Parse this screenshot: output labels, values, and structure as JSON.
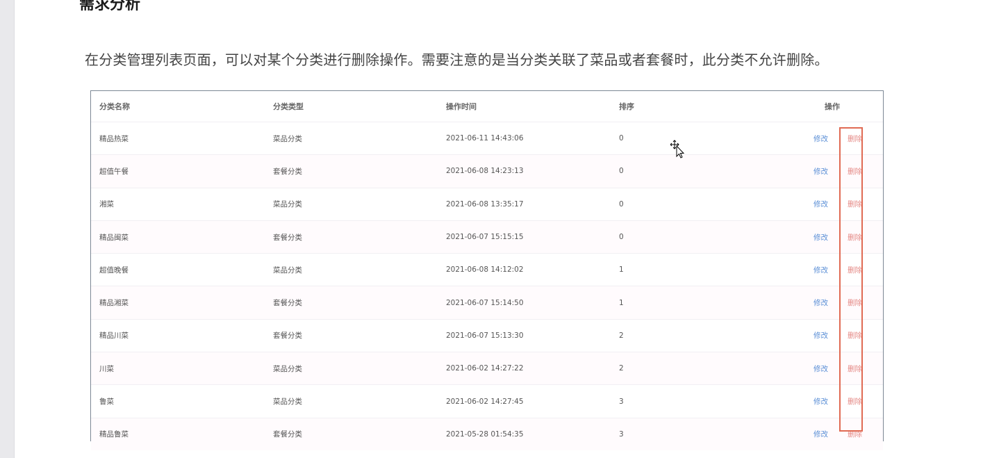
{
  "document": {
    "heading": "需求分析",
    "paragraph": "在分类管理列表页面，可以对某个分类进行删除操作。需要注意的是当分类关联了菜品或者套餐时，此分类不允许删除。"
  },
  "table": {
    "headers": {
      "name": "分类名称",
      "type": "分类类型",
      "time": "操作时间",
      "sort": "排序",
      "ops": "操作"
    },
    "edit_label": "修改",
    "delete_label": "删除",
    "rows": [
      {
        "name": "精品热菜",
        "type": "菜品分类",
        "time": "2021-06-11 14:43:06",
        "sort": "0"
      },
      {
        "name": "超值午餐",
        "type": "套餐分类",
        "time": "2021-06-08 14:23:13",
        "sort": "0"
      },
      {
        "name": "湘菜",
        "type": "菜品分类",
        "time": "2021-06-08 13:35:17",
        "sort": "0"
      },
      {
        "name": "精品闽菜",
        "type": "套餐分类",
        "time": "2021-06-07 15:15:15",
        "sort": "0"
      },
      {
        "name": "超值晚餐",
        "type": "菜品分类",
        "time": "2021-06-08 14:12:02",
        "sort": "1"
      },
      {
        "name": "精品湘菜",
        "type": "套餐分类",
        "time": "2021-06-07 15:14:50",
        "sort": "1"
      },
      {
        "name": "精品川菜",
        "type": "套餐分类",
        "time": "2021-06-07 15:13:30",
        "sort": "2"
      },
      {
        "name": "川菜",
        "type": "菜品分类",
        "time": "2021-06-02 14:27:22",
        "sort": "2"
      },
      {
        "name": "鲁菜",
        "type": "菜品分类",
        "time": "2021-06-02 14:27:45",
        "sort": "3"
      },
      {
        "name": "精品鲁菜",
        "type": "套餐分类",
        "time": "2021-05-28 01:54:35",
        "sort": "3"
      }
    ]
  },
  "colors": {
    "edit": "#5b8fd6",
    "delete": "#e58a86",
    "highlight": "#e06a53"
  }
}
